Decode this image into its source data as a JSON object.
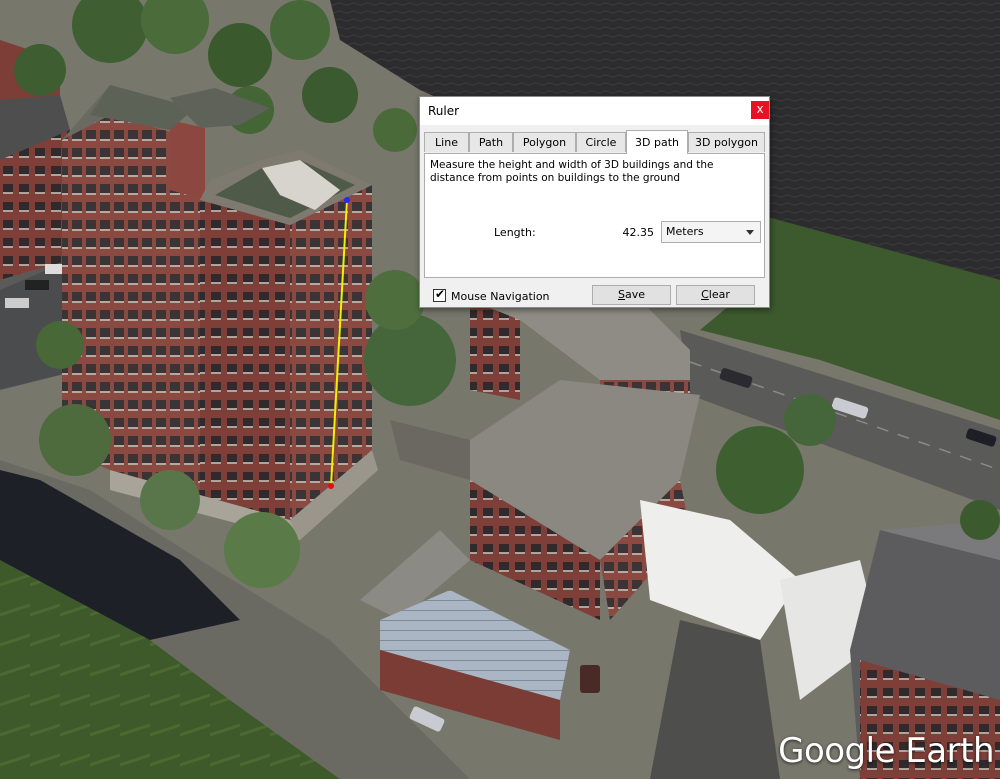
{
  "ruler": {
    "title": "Ruler",
    "close_label": "x",
    "tabs": [
      {
        "label": "Line",
        "active": false
      },
      {
        "label": "Path",
        "active": false
      },
      {
        "label": "Polygon",
        "active": false
      },
      {
        "label": "Circle",
        "active": false
      },
      {
        "label": "3D path",
        "active": true
      },
      {
        "label": "3D polygon",
        "active": false
      }
    ],
    "description": "Measure the height and width of 3D buildings and the distance from points on buildings to the ground",
    "length_label": "Length:",
    "length_value": "42.35",
    "unit_selected": "Meters",
    "mouse_navigation": {
      "label": "Mouse Navigation",
      "checked": true,
      "check_glyph": "✔"
    },
    "save_label": "Save",
    "clear_label": "Clear"
  },
  "brand": "Google Earth",
  "colors": {
    "measure_line": "#f0f000",
    "start_point": "#e01010",
    "end_point": "#1a2cff",
    "close_button": "#e81123"
  }
}
